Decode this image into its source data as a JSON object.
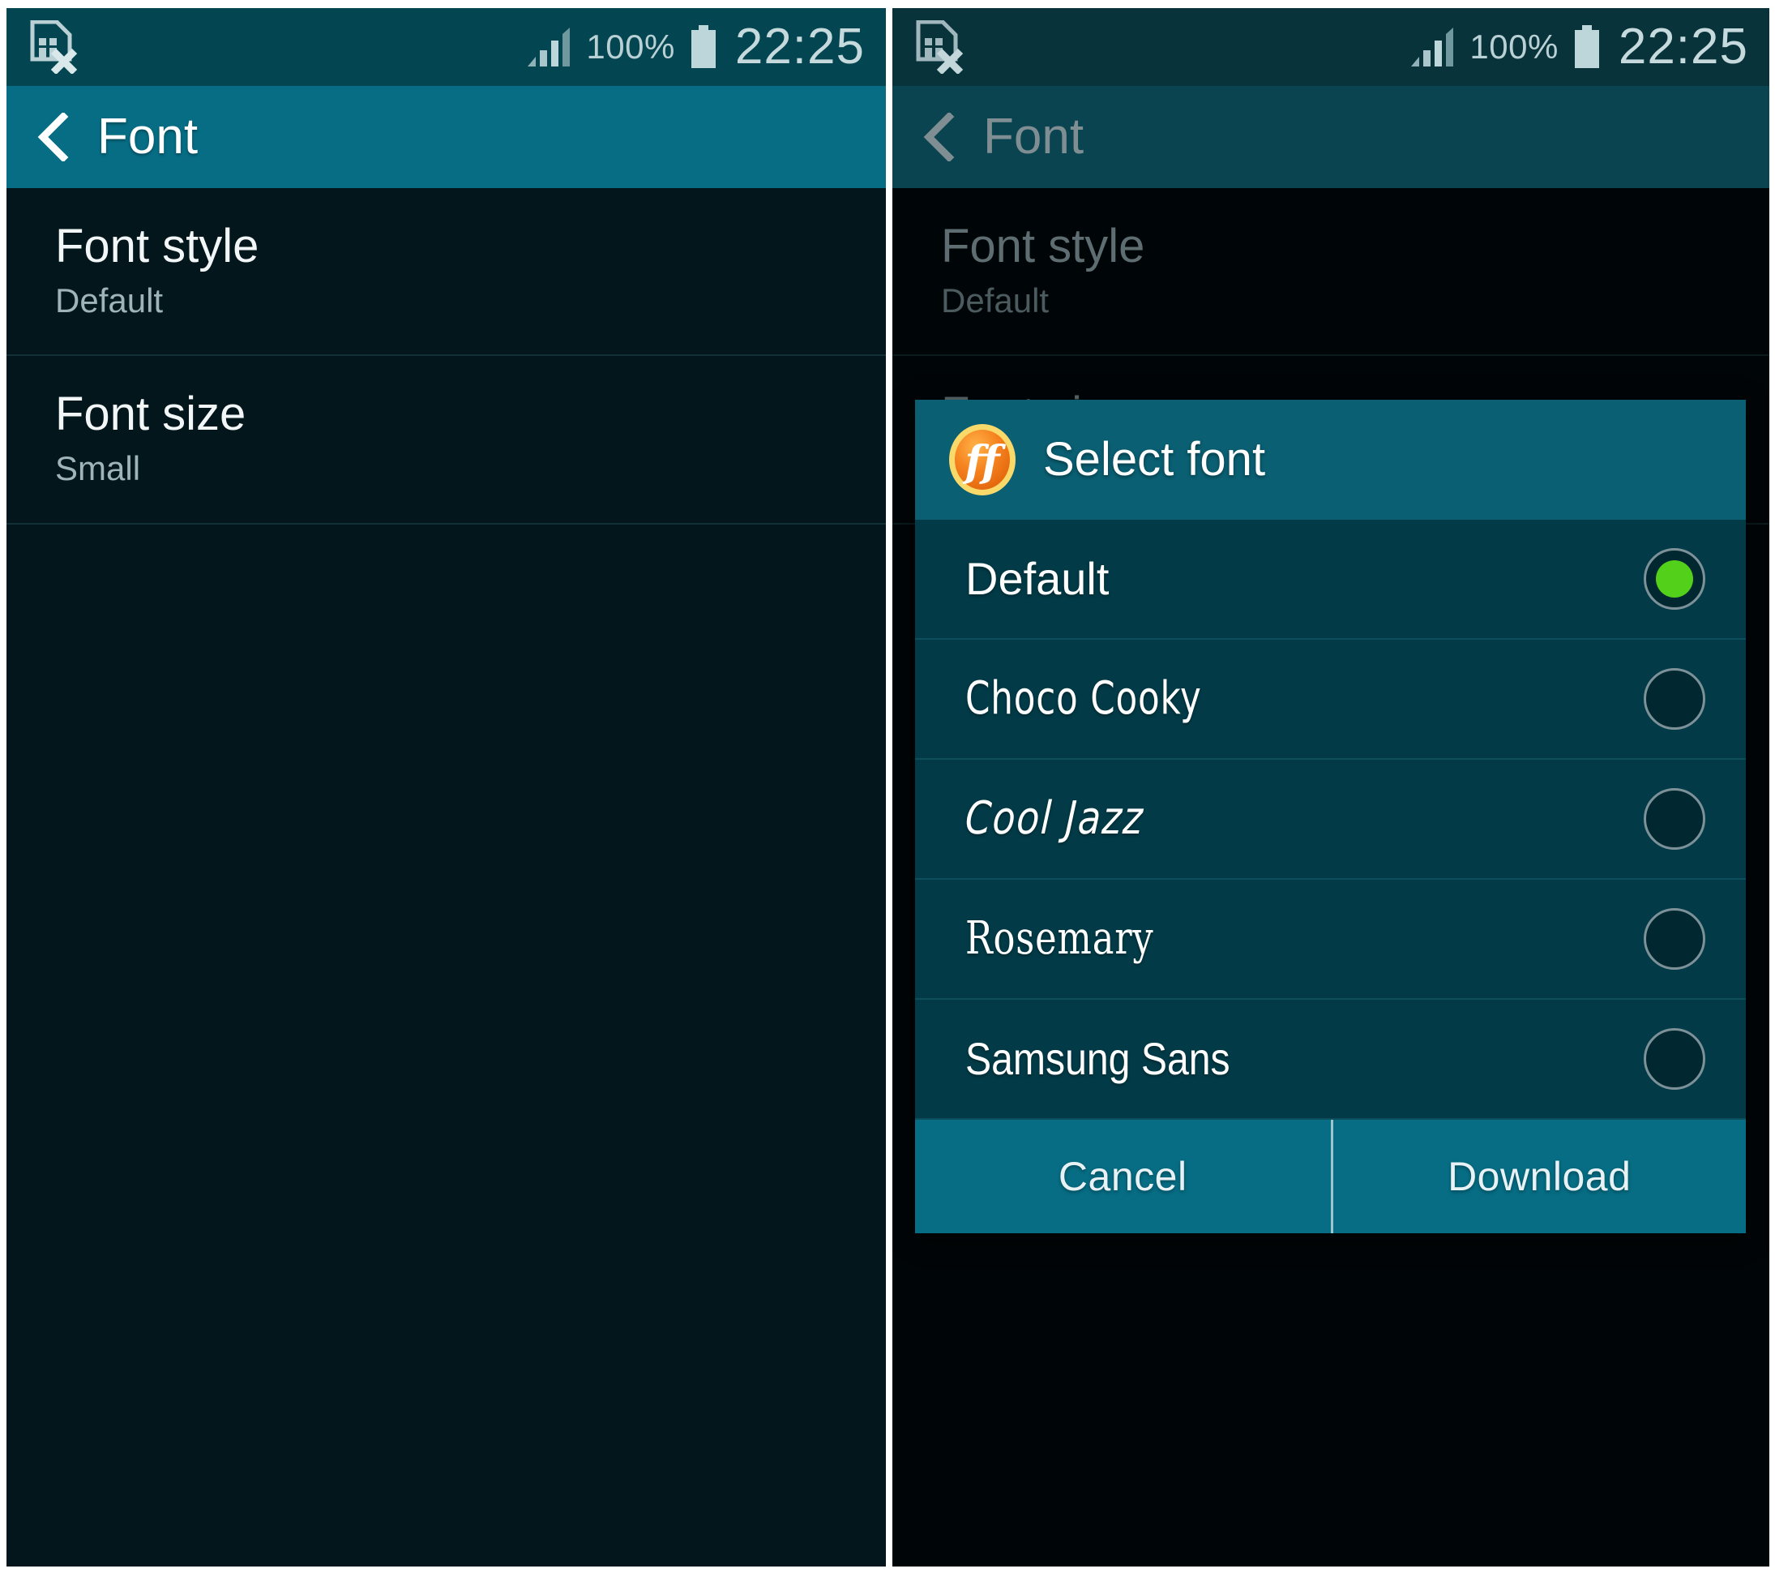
{
  "status_bar": {
    "sim_icon": "sim-card-x-icon",
    "signal_icon": "signal-bars-icon",
    "battery_percent": "100%",
    "battery_icon": "battery-full-icon",
    "clock": "22:25"
  },
  "action_bar": {
    "back_icon": "back-chevron-icon",
    "title": "Font"
  },
  "settings": {
    "items": [
      {
        "title": "Font style",
        "value": "Default"
      },
      {
        "title": "Font size",
        "value": "Small"
      }
    ]
  },
  "dialog": {
    "icon": "ff-flipfont-icon",
    "title": "Select font",
    "options": [
      {
        "label": "Default",
        "selected": true
      },
      {
        "label": "Choco Cooky",
        "selected": false
      },
      {
        "label": "Cool Jazz",
        "selected": false
      },
      {
        "label": "Rosemary",
        "selected": false
      },
      {
        "label": "Samsung Sans",
        "selected": false
      }
    ],
    "buttons": {
      "cancel": "Cancel",
      "download": "Download"
    }
  },
  "colors": {
    "action_bar": "#066d84",
    "status_bar": "#034651",
    "body": "#02161c",
    "dialog_body": "#023b47",
    "dialog_header": "#0a5f72",
    "radio_selected": "#52d01a",
    "ff_badge_orange": "#f07c1c",
    "ff_badge_ring": "#f7d44a"
  }
}
